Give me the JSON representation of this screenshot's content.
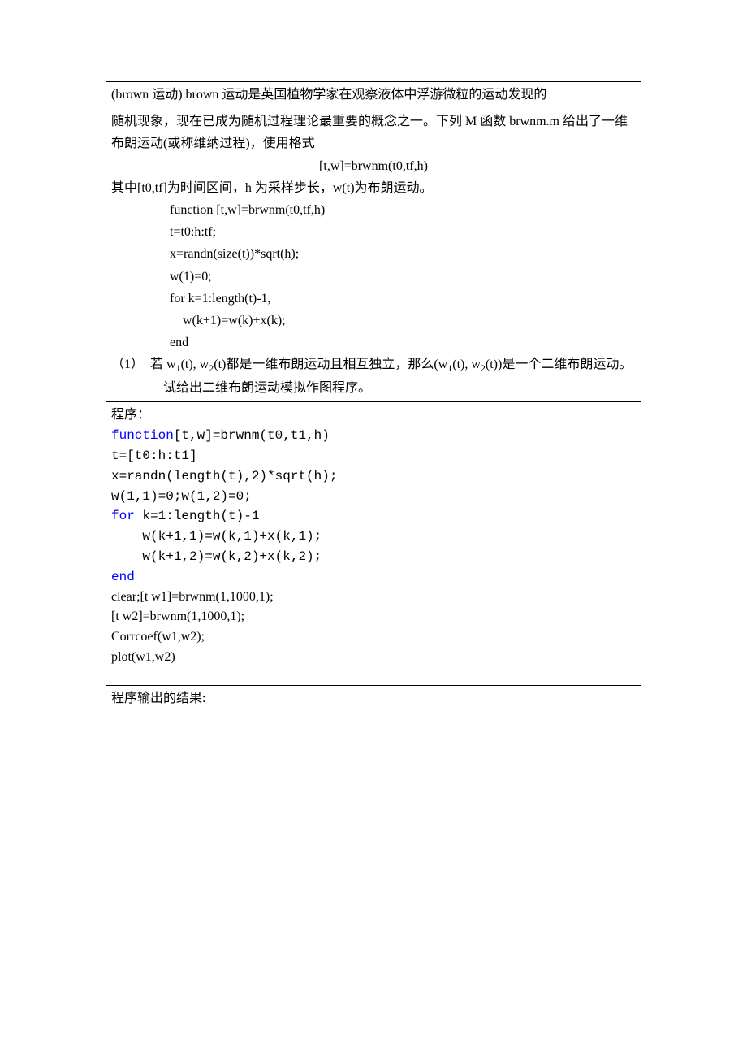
{
  "section1": {
    "p1_a": "(brown 运动)   brown 运动是英国植物学家在观察液体中浮游微粒的运动发现的",
    "p1_b": "随机现象，现在已成为随机过程理论最重要的概念之一。下列 M 函数 brwnm.m 给出了一维布朗运动(或称维纳过程)，使用格式",
    "formula": "[t,w]=brwnm(t0,tf,h)",
    "p2": "其中[t0,tf]为时间区间，h 为采样步长，w(t)为布朗运动。",
    "code": [
      "function [t,w]=brwnm(t0,tf,h)",
      "t=t0:h:tf;",
      "x=randn(size(t))*sqrt(h);",
      "w(1)=0;",
      "for k=1:length(t)-1,",
      "    w(k+1)=w(k)+x(k);",
      "end"
    ],
    "q1_label": "（1）",
    "q1_a": "若 w",
    "q1_b": "(t), w",
    "q1_c": "(t)都是一维布朗运动且相互独立，那么(w",
    "q1_d": "(t), w",
    "q1_e": "(t))是一个二维布朗运动。试给出二维布朗运动模拟作图程序。",
    "sub1": "1",
    "sub2": "2"
  },
  "section2": {
    "title": "程序：",
    "code": {
      "l1_a": "function",
      "l1_b": "[t,w]=brwnm(t0,t1,h)",
      "l2": "t=[t0:h:t1]",
      "l3": "x=randn(length(t),2)*sqrt(h);",
      "l4": "w(1,1)=0;w(1,2)=0;",
      "l5_a": "for",
      "l5_b": " k=1:length(t)-1",
      "l6": "    w(k+1,1)=w(k,1)+x(k,1);",
      "l7": "    w(k+1,2)=w(k,2)+x(k,2);",
      "l8": "end"
    },
    "after": [
      "clear;[t w1]=brwnm(1,1000,1);",
      "[t w2]=brwnm(1,1000,1);",
      "Corrcoef(w1,w2);",
      "plot(w1,w2)"
    ]
  },
  "section3": {
    "title": "程序输出的结果:"
  }
}
